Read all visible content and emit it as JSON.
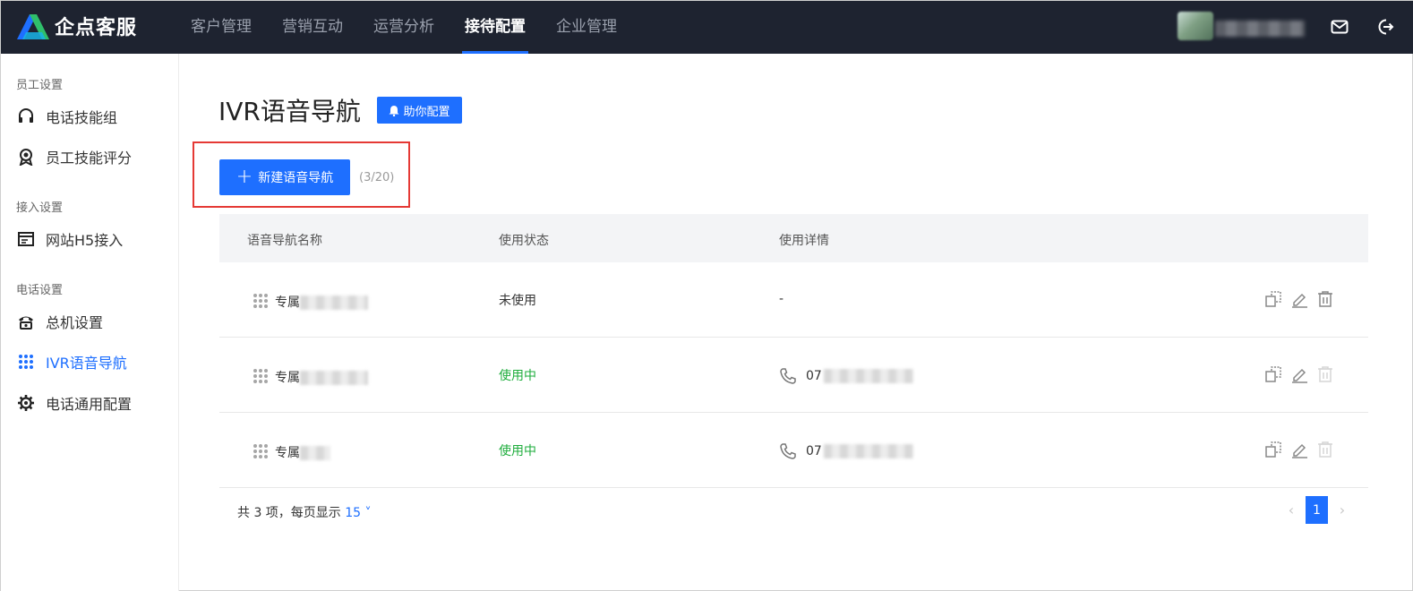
{
  "app": {
    "name": "企点客服"
  },
  "nav": {
    "items": [
      "客户管理",
      "营销互动",
      "运营分析",
      "接待配置",
      "企业管理"
    ],
    "active_index": 3
  },
  "sidebar": {
    "groups": [
      {
        "title": "员工设置",
        "items": [
          {
            "label": "电话技能组",
            "icon": "headset-icon"
          },
          {
            "label": "员工技能评分",
            "icon": "award-icon"
          }
        ]
      },
      {
        "title": "接入设置",
        "items": [
          {
            "label": "网站H5接入",
            "icon": "browser-icon"
          }
        ]
      },
      {
        "title": "电话设置",
        "items": [
          {
            "label": "总机设置",
            "icon": "telephone-icon"
          },
          {
            "label": "IVR语音导航",
            "icon": "grid-dots-icon"
          },
          {
            "label": "电话通用配置",
            "icon": "gear-icon"
          }
        ]
      }
    ],
    "active_item": "IVR语音导航"
  },
  "main": {
    "title": "IVR语音导航",
    "helper_button": "助你配置",
    "new_button": "新建语音导航",
    "quota": "(3/20)",
    "table": {
      "headers": [
        "语音导航名称",
        "使用状态",
        "使用详情"
      ],
      "rows": [
        {
          "name": "专属",
          "status": "未使用",
          "status_type": "unused",
          "detail": "-"
        },
        {
          "name": "专属",
          "status": "使用中",
          "status_type": "inuse",
          "detail": "07"
        },
        {
          "name": "专属",
          "status": "使用中",
          "status_type": "inuse",
          "detail": "07"
        }
      ]
    },
    "footer": {
      "total_text": "共 3 项，每页显示",
      "page_size": "15",
      "current_page": "1"
    }
  },
  "colors": {
    "primary": "#1e6fff",
    "topbar": "#1e2330",
    "success": "#1ead3c",
    "highlight": "#e53935"
  }
}
